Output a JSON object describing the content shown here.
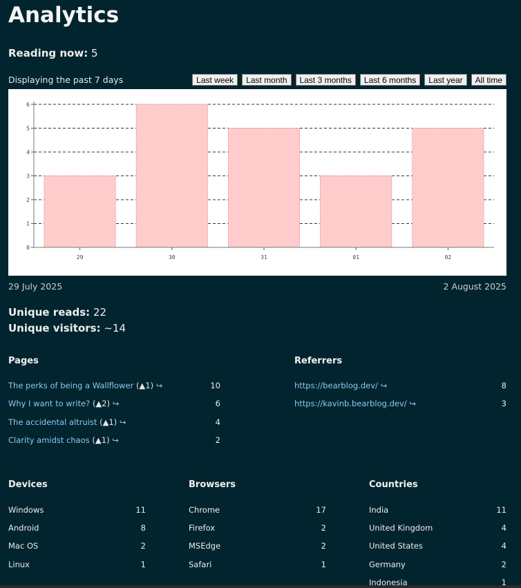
{
  "title": "Analytics",
  "reading": {
    "label": "Reading now:",
    "value": "5"
  },
  "range_note": "Displaying the past 7 days",
  "range_buttons": [
    "Last week",
    "Last month",
    "Last 3 months",
    "Last 6 months",
    "Last year",
    "All time"
  ],
  "chart_data": {
    "type": "bar",
    "categories": [
      "29",
      "30",
      "31",
      "01",
      "02"
    ],
    "values": [
      3,
      6,
      5,
      3,
      5
    ],
    "ylim": [
      0,
      6
    ],
    "yticks": [
      0,
      1,
      2,
      3,
      4,
      5,
      6
    ],
    "grid": true,
    "bar_color": "#ffcccc"
  },
  "date_start": "29 July 2025",
  "date_end": "2 August 2025",
  "unique_reads": {
    "label": "Unique reads:",
    "value": "22"
  },
  "unique_visitors": {
    "label": "Unique visitors:",
    "value": "~14"
  },
  "pages": {
    "heading": "Pages",
    "items": [
      {
        "title": "The perks of being a Wallflower",
        "badge": "(▲1)",
        "arrow": "↪",
        "count": "10"
      },
      {
        "title": "Why I want to write?",
        "badge": "(▲2)",
        "arrow": "↪",
        "count": "6"
      },
      {
        "title": "The accidental altruist",
        "badge": "(▲1)",
        "arrow": "↪",
        "count": "4"
      },
      {
        "title": "Clarity amidst chaos",
        "badge": "(▲1)",
        "arrow": "↪",
        "count": "2"
      }
    ]
  },
  "referrers": {
    "heading": "Referrers",
    "items": [
      {
        "title": "https://bearblog.dev/",
        "arrow": "↪",
        "count": "8"
      },
      {
        "title": "https://kavinb.bearblog.dev/",
        "arrow": "↪",
        "count": "3"
      }
    ]
  },
  "devices": {
    "heading": "Devices",
    "items": [
      {
        "name": "Windows",
        "count": "11"
      },
      {
        "name": "Android",
        "count": "8"
      },
      {
        "name": "Mac OS",
        "count": "2"
      },
      {
        "name": "Linux",
        "count": "1"
      }
    ]
  },
  "browsers": {
    "heading": "Browsers",
    "items": [
      {
        "name": "Chrome",
        "count": "17"
      },
      {
        "name": "Firefox",
        "count": "2"
      },
      {
        "name": "MSEdge",
        "count": "2"
      },
      {
        "name": "Safari",
        "count": "1"
      }
    ]
  },
  "countries": {
    "heading": "Countries",
    "items": [
      {
        "name": "India",
        "count": "11"
      },
      {
        "name": "United Kingdom",
        "count": "4"
      },
      {
        "name": "United States",
        "count": "4"
      },
      {
        "name": "Germany",
        "count": "2"
      },
      {
        "name": "Indonesia",
        "count": "1"
      }
    ]
  }
}
